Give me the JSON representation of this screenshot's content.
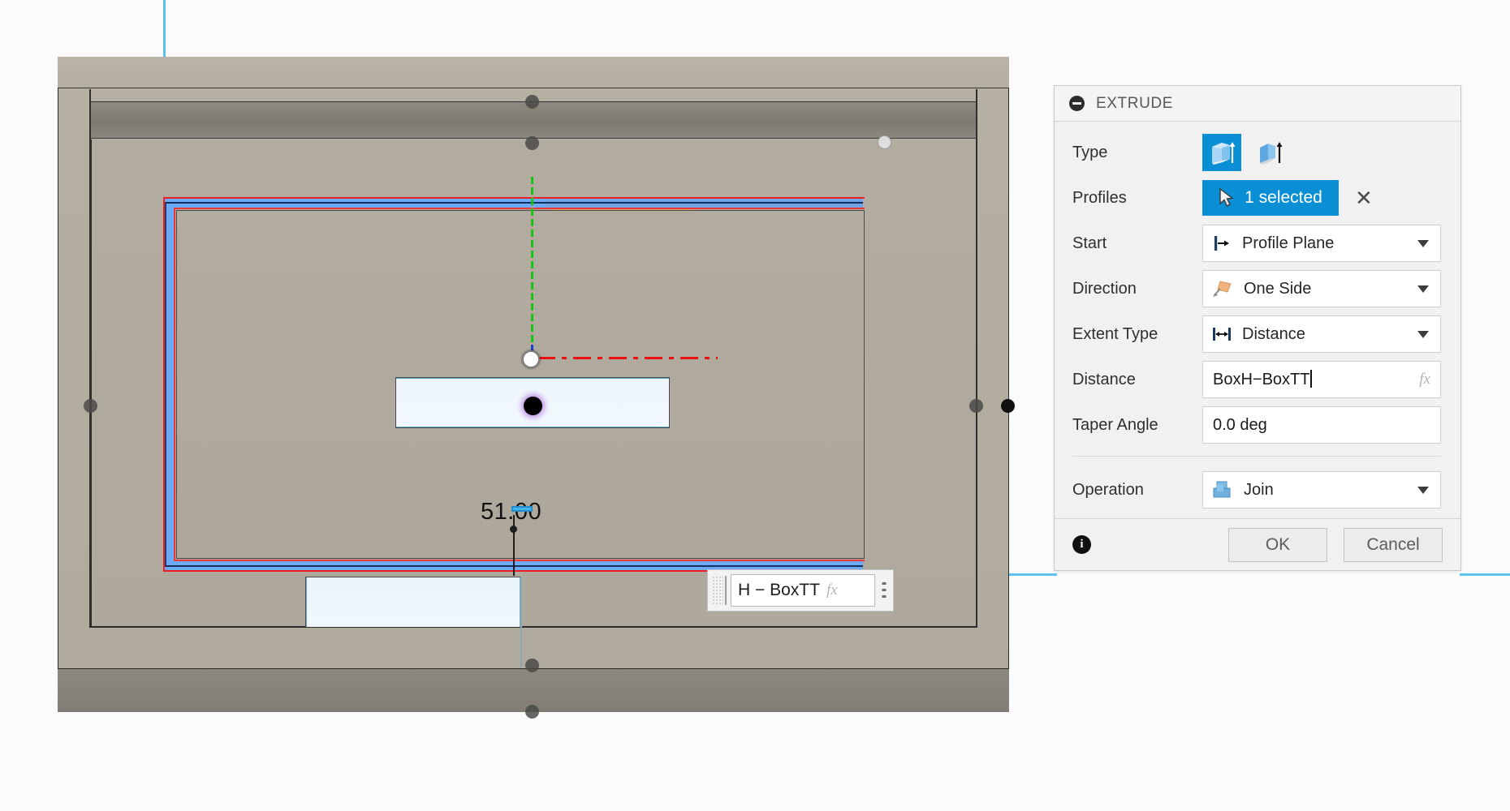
{
  "viewport": {
    "dimension_label": "51.00",
    "manipulator": {
      "value": "H − BoxTT",
      "fx_label": "fx",
      "grip_icon": "drag-grip-icon",
      "menu_icon": "overflow-dots-icon"
    },
    "origin_icon": "origin-point-icon",
    "axis_green": "y-axis-green",
    "axis_red": "x-axis-red"
  },
  "panel": {
    "title": "EXTRUDE",
    "collapse_icon": "collapse-icon",
    "rows": {
      "type": {
        "label": "Type",
        "options": [
          {
            "name": "solid-extrude-icon",
            "selected": true
          },
          {
            "name": "thin-extrude-icon",
            "selected": false
          }
        ]
      },
      "profiles": {
        "label": "Profiles",
        "value": "1 selected",
        "cursor_icon": "arrow-cursor-icon",
        "clear_icon": "✕"
      },
      "start": {
        "label": "Start",
        "value": "Profile Plane",
        "icon": "profile-plane-icon"
      },
      "direction": {
        "label": "Direction",
        "value": "One Side",
        "icon": "one-side-icon"
      },
      "extent_type": {
        "label": "Extent Type",
        "value": "Distance",
        "icon": "distance-icon"
      },
      "distance": {
        "label": "Distance",
        "value": "BoxH−BoxTT",
        "fx_label": "fx"
      },
      "taper_angle": {
        "label": "Taper Angle",
        "value": "0.0 deg"
      },
      "operation": {
        "label": "Operation",
        "value": "Join",
        "icon": "join-icon"
      }
    },
    "footer": {
      "info_icon": "info-icon",
      "info_glyph": "i",
      "ok_label": "OK",
      "cancel_label": "Cancel"
    }
  },
  "colors": {
    "accent_blue": "#0a8fd4",
    "selection_blue": "#6aaaf7",
    "highlight_red": "#ef1f1f",
    "preview_orange": "#e2aa52",
    "axis_green": "#15c415",
    "construction_cyan": "#5cc3ef",
    "body_gray": "#b2aca0"
  }
}
